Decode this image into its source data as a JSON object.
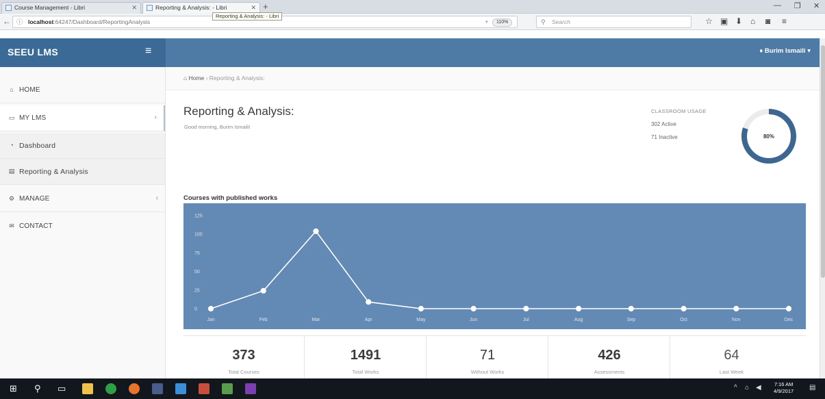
{
  "browser": {
    "tabs": [
      {
        "label": "Course Management - Libri",
        "close": "✕"
      },
      {
        "label": "Reporting & Analysis: - Libri",
        "close": "✕"
      }
    ],
    "new_tab": "+",
    "tooltip": "Reporting & Analysis: - Libri",
    "window_controls": {
      "minimize": "—",
      "maximize": "❐",
      "close": "✕"
    },
    "url_host": "localhost",
    "url_rest": ":64247/Dashboard/ReportingAnalysis",
    "zoom": "110%",
    "search_placeholder": "Search"
  },
  "app": {
    "brand": "SEEU LMS",
    "user": "Burim Ismaili"
  },
  "sidebar": {
    "items": [
      {
        "label": "HOME",
        "icon": "home-icon",
        "glyph": "⌂",
        "has_chevron": false
      },
      {
        "label": "MY LMS",
        "icon": "folder-icon",
        "glyph": "▭",
        "has_chevron": true,
        "active": true
      },
      {
        "label": "Dashboard",
        "icon": "dashboard-icon",
        "glyph": "◔",
        "sub": true
      },
      {
        "label": "Reporting & Analysis",
        "icon": "chart-icon",
        "glyph": "▤",
        "sub": true
      },
      {
        "label": "MANAGE",
        "icon": "cogs-icon",
        "glyph": "⚙",
        "has_chevron": true
      },
      {
        "label": "CONTACT",
        "icon": "envelope-icon",
        "glyph": "✉",
        "has_chevron": false
      }
    ]
  },
  "breadcrumb": {
    "home": "Home",
    "sep": "›",
    "current": "Reporting & Analysis:"
  },
  "page": {
    "title": "Reporting & Analysis:",
    "greeting": "Good morning, Burim Ismaili!"
  },
  "classroom_usage": {
    "title": "CLASSROOM USAGE",
    "active": "302 Active",
    "inactive": "71 Inactive",
    "percent_label": "80%",
    "percent": 80,
    "ring_color": "#3d6690",
    "track_color": "#ececec"
  },
  "chart_data": {
    "type": "line",
    "title": "Courses with published works",
    "categories": [
      "Jan",
      "Feb",
      "Mar",
      "Apr",
      "May",
      "Jun",
      "Jul",
      "Aug",
      "Sep",
      "Oct",
      "Nov",
      "Dec"
    ],
    "values": [
      0,
      24,
      104,
      9,
      0,
      0,
      0,
      0,
      0,
      0,
      0,
      0
    ],
    "yticks": [
      "0",
      "25",
      "50",
      "75",
      "100",
      "125"
    ],
    "ylim": [
      0,
      125
    ],
    "background": "#6389b5",
    "line_color": "#ffffff"
  },
  "stats": [
    {
      "value": "373",
      "label": "Total Courses"
    },
    {
      "value": "1491",
      "label": "Total Works"
    },
    {
      "value": "71",
      "label": "Without Works"
    },
    {
      "value": "426",
      "label": "Assessments"
    },
    {
      "value": "64",
      "label": "Last Week"
    }
  ],
  "taskbar": {
    "time": "7:16 AM",
    "date": "4/9/2017",
    "tray": "^"
  }
}
